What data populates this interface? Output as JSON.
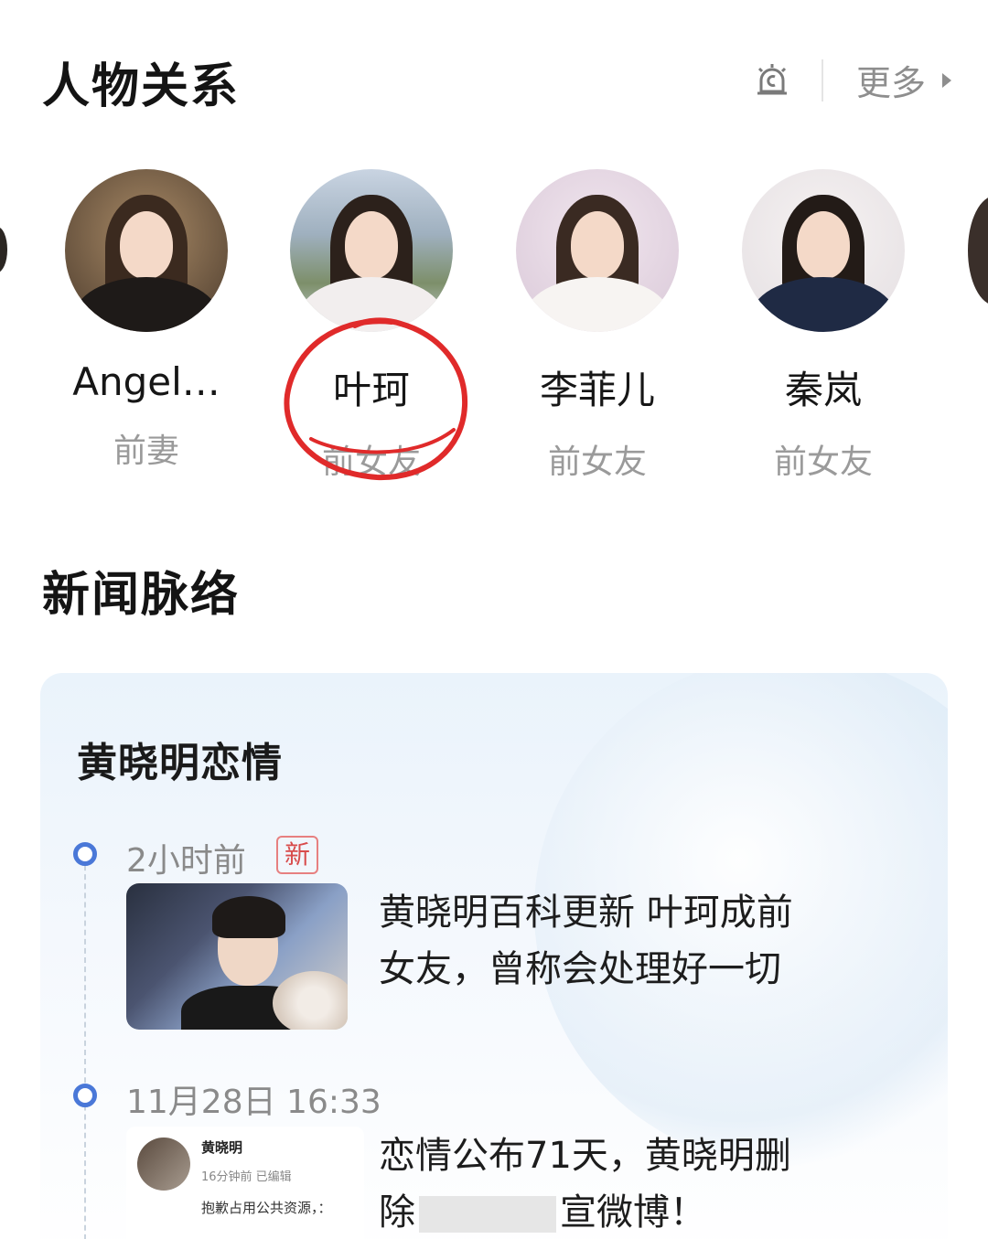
{
  "relations": {
    "title": "人物关系",
    "more_label": "更多",
    "icons": {
      "alert": "alert-bell-icon",
      "arrow": "triangle-right-icon"
    },
    "people": [
      {
        "name": "Angel…",
        "role": "前妻"
      },
      {
        "name": "叶珂",
        "role": "前女友"
      },
      {
        "name": "李菲儿",
        "role": "前女友"
      },
      {
        "name": "秦岚",
        "role": "前女友"
      }
    ],
    "highlight_color": "#e02a2a"
  },
  "news": {
    "title": "新闻脉络",
    "topic": "黄晓明恋情",
    "accent_color": "#4a78d8",
    "items": [
      {
        "time": "2小时前",
        "badge": "新",
        "text_line1": "黄晓明百科更新 叶珂成前",
        "text_line2": "女友，曾称会处理好一切"
      },
      {
        "time": "11月28日 16:33",
        "text_line1": "恋情公布71天，黄晓明删",
        "text_line2": "除",
        "text_line2_tail": "宣微博！",
        "thumb": {
          "name": "黄晓明",
          "meta": "16分钟前  已编辑",
          "text": "抱歉占用公共资源，："
        }
      }
    ]
  }
}
